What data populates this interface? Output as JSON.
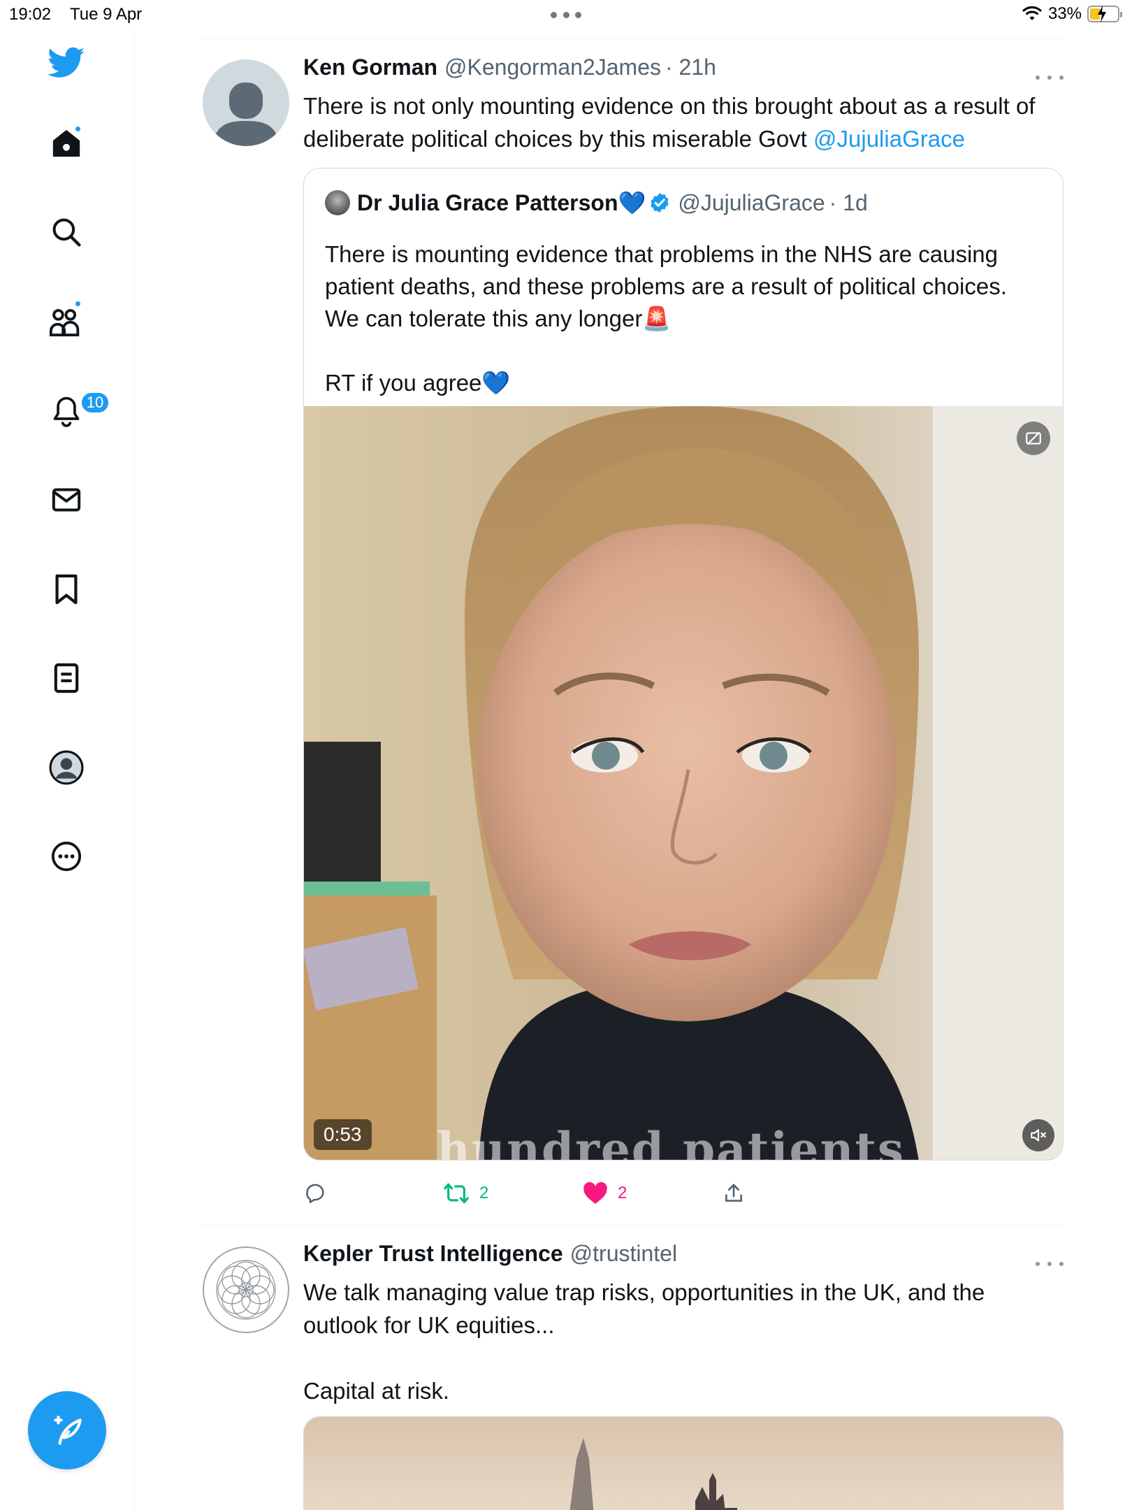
{
  "status_bar": {
    "time": "19:02",
    "date": "Tue 9 Apr",
    "battery": "33%"
  },
  "sidebar": {
    "items": [
      {
        "name": "home",
        "has_dot": true
      },
      {
        "name": "search"
      },
      {
        "name": "communities",
        "has_dot": true
      },
      {
        "name": "notifications",
        "badge": "10"
      },
      {
        "name": "messages"
      },
      {
        "name": "bookmarks"
      },
      {
        "name": "lists"
      },
      {
        "name": "profile"
      },
      {
        "name": "more"
      }
    ],
    "accent": "#1d9bf0"
  },
  "tweets": [
    {
      "name": "Ken Gorman",
      "handle": "@Kengorman2James",
      "time": "· 21h",
      "text": "There is not only mounting evidence on this brought about as a result of\ndeliberate political choices by this miserable Govt ",
      "mention": "@JujuliaGrace",
      "quote": {
        "name": "Dr Julia Grace Patterson💙",
        "handle": "@JujuliaGrace",
        "time": "· 1d",
        "text": "There is mounting evidence that problems in the NHS are causing\npatient deaths, and these problems are a result of political choices.\nWe can tolerate this any longer🚨\n\nRT if you agree💙",
        "video_duration": "0:53",
        "video_caption": "hundred patients"
      },
      "actions": {
        "retweets": "2",
        "likes": "2"
      }
    },
    {
      "name": "Kepler Trust Intelligence",
      "handle": "@trustintel",
      "text": "We talk managing value trap risks, opportunities in the UK, and the\noutlook for UK equities...\n\nCapital at risk."
    }
  ],
  "colors": {
    "like": "#f91880",
    "retweet": "#00ba7c",
    "secondary": "#536471"
  }
}
